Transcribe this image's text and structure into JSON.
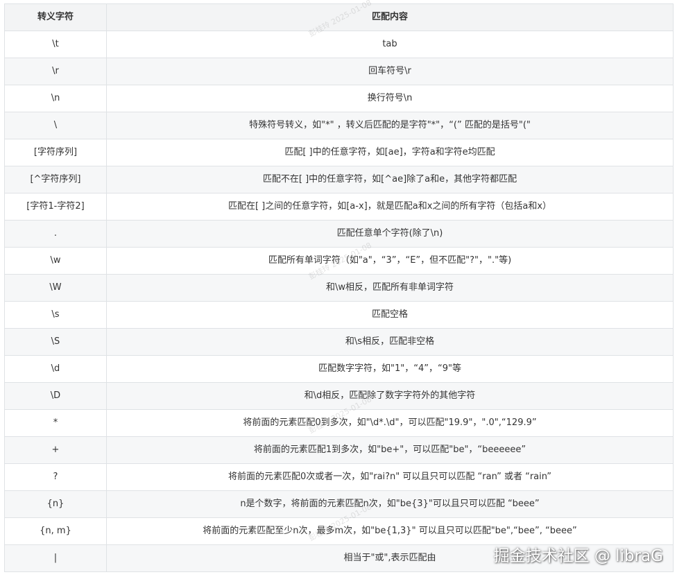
{
  "table": {
    "headers": [
      "转义字符",
      "匹配内容"
    ],
    "rows": [
      [
        "\\t",
        "tab"
      ],
      [
        "\\r",
        "回车符号\\r"
      ],
      [
        "\\n",
        "换行符号\\n"
      ],
      [
        "\\",
        "特殊符号转义，如\"*\" ，转义后匹配的是字符\"*\"，“(” 匹配的是括号\"(\""
      ],
      [
        "[字符序列]",
        "匹配[ ]中的任意字符，如[ae]，字符a和字符e均匹配"
      ],
      [
        "[^字符序列]",
        "匹配不在[ ]中的任意字符，如[^ae]除了a和e，其他字符都匹配"
      ],
      [
        "[字符1-字符2]",
        "匹配在[ ]之间的任意字符，如[a-x]，就是匹配a和x之间的所有字符（包括a和x）"
      ],
      [
        ".",
        "匹配任意单个字符(除了\\n)"
      ],
      [
        "\\w",
        "匹配所有单词字符（如\"a\"，“3”，“E”，但不匹配\"?\"，\".\"等)"
      ],
      [
        "\\W",
        "和\\w相反，匹配所有非单词字符"
      ],
      [
        "\\s",
        "匹配空格"
      ],
      [
        "\\S",
        "和\\s相反，匹配非空格"
      ],
      [
        "\\d",
        "匹配数字字符，如\"1\"，“4”，“9\"等"
      ],
      [
        "\\D",
        "和\\d相反，匹配除了数字字符外的其他字符"
      ],
      [
        "*",
        "将前面的元素匹配0到多次，如\"\\d*.\\d\"，可以匹配\"19.9\"，\".0\",“129.9”"
      ],
      [
        "+",
        "将前面的元素匹配1到多次，如\"be+\"，可以匹配\"be\"，“beeeeee”"
      ],
      [
        "?",
        "将前面的元素匹配0次或者一次，如\"rai?n\" 可以且只可以匹配 “ran” 或者 “rain”"
      ],
      [
        "{n}",
        "n是个数字，将前面的元素匹配n次，如\"be{3}\"可以且只可以匹配 “beee”"
      ],
      [
        "{n, m}",
        "将前面的元素匹配至少n次，最多m次，如\"be{1,3}\" 可以且只可以匹配\"be\",“bee”, “beee”"
      ],
      [
        "|",
        "相当于\"或\",表示匹配由"
      ]
    ]
  },
  "watermarks": [
    "彭桂玲  2025-01-08",
    "彭桂玲  2025-01-08",
    "彭桂玲  2025-01-08",
    "彭桂玲  2025-01-08"
  ],
  "brand": "掘金技术社区 @ libraG"
}
